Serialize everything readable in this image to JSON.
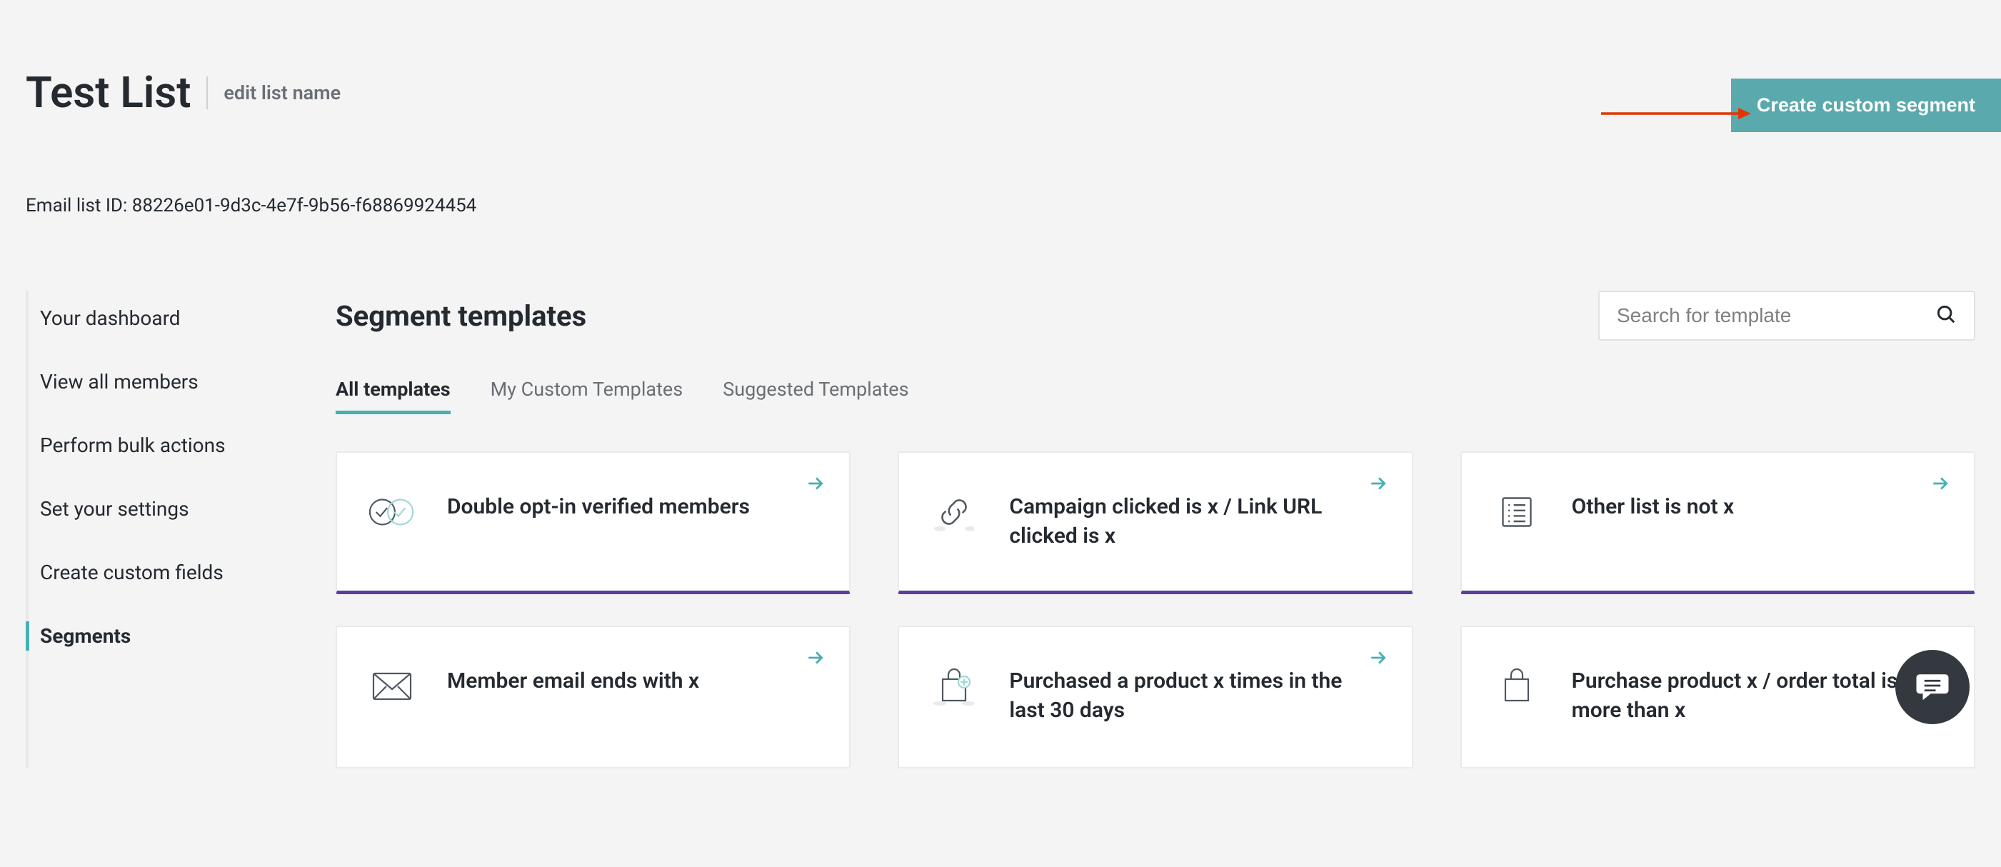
{
  "header": {
    "title": "Test List",
    "edit_label": "edit list name",
    "create_button": "Create custom segment"
  },
  "list_id": {
    "prefix": "Email list ID: ",
    "value": "88226e01-9d3c-4e7f-9b56-f68869924454"
  },
  "sidebar": {
    "items": [
      {
        "label": "Your dashboard",
        "active": false
      },
      {
        "label": "View all members",
        "active": false
      },
      {
        "label": "Perform bulk actions",
        "active": false
      },
      {
        "label": "Set your settings",
        "active": false
      },
      {
        "label": "Create custom fields",
        "active": false
      },
      {
        "label": "Segments",
        "active": true
      }
    ]
  },
  "section": {
    "title": "Segment templates",
    "search_placeholder": "Search for template"
  },
  "tabs": [
    {
      "label": "All templates",
      "active": true
    },
    {
      "label": "My Custom Templates",
      "active": false
    },
    {
      "label": "Suggested Templates",
      "active": false
    }
  ],
  "cards": [
    {
      "title": "Double opt-in verified members",
      "icon": "double-check-icon",
      "accent": true
    },
    {
      "title": "Campaign clicked is x / Link URL clicked is x",
      "icon": "link-icon",
      "accent": true
    },
    {
      "title": "Other list is not x",
      "icon": "list-icon",
      "accent": true
    },
    {
      "title": "Member email ends with x",
      "icon": "envelope-icon",
      "accent": false
    },
    {
      "title": "Purchased a product x times in the last 30 days",
      "icon": "shopping-bag-plus-icon",
      "accent": false
    },
    {
      "title": "Purchase product x / order total is more than x",
      "icon": "shopping-bag-icon",
      "accent": false
    }
  ],
  "icon_names": {
    "search": "search-icon",
    "go": "arrow-right-icon",
    "chat": "chat-icon",
    "annotation_arrow": "annotation-arrow-icon"
  },
  "colors": {
    "accent_teal": "#45b0b3",
    "button_teal": "#5aa9ac",
    "card_accent_purple": "#5b3e9b",
    "annotation_red": "#e23500",
    "fab_bg": "#33393f"
  }
}
